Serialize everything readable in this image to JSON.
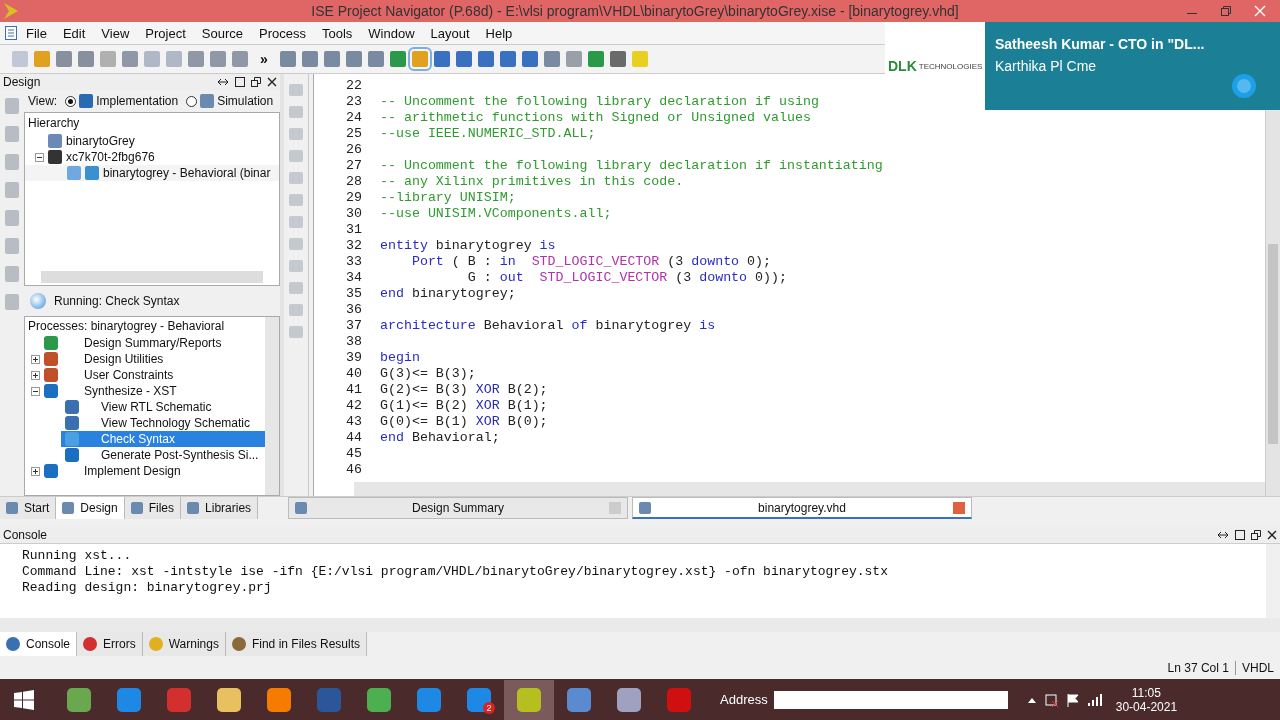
{
  "window": {
    "title": "ISE Project Navigator (P.68d) - E:\\vlsi program\\VHDL\\binarytoGrey\\binarytoGrey.xise - [binarytogrey.vhd]"
  },
  "menu": [
    "File",
    "Edit",
    "View",
    "Project",
    "Source",
    "Process",
    "Tools",
    "Window",
    "Layout",
    "Help"
  ],
  "toolbar": {
    "overflow": "»"
  },
  "design_panel": {
    "title": "Design",
    "view_label": "View:",
    "view_options": [
      {
        "label": "Implementation",
        "selected": true
      },
      {
        "label": "Simulation",
        "selected": false
      }
    ],
    "hierarchy_title": "Hierarchy",
    "hierarchy": [
      {
        "label": "binarytoGrey",
        "kind": "project"
      },
      {
        "label": "xc7k70t-2fbg676",
        "kind": "chip",
        "expanded": true,
        "children": [
          {
            "label": "binarytogrey - Behavioral (binar",
            "kind": "vhdl"
          }
        ]
      }
    ],
    "running": "Running: Check Syntax",
    "processes_title": "Processes: binarytogrey - Behavioral",
    "processes": [
      {
        "label": "Design Summary/Reports",
        "kind": "sigma",
        "selected": false
      },
      {
        "label": "Design Utilities",
        "kind": "tools",
        "expanded": false,
        "selected": false
      },
      {
        "label": "User Constraints",
        "kind": "tools",
        "expanded": false,
        "selected": false
      },
      {
        "label": "Synthesize - XST",
        "kind": "cycle",
        "expanded": true,
        "selected": false,
        "children": [
          {
            "label": "View RTL Schematic",
            "kind": "doc",
            "selected": false
          },
          {
            "label": "View Technology Schematic",
            "kind": "doc",
            "selected": false
          },
          {
            "label": "Check Syntax",
            "kind": "running",
            "selected": true
          },
          {
            "label": "Generate Post-Synthesis Si...",
            "kind": "cycle",
            "selected": false
          }
        ]
      },
      {
        "label": "Implement Design",
        "kind": "cycle",
        "expanded": false,
        "selected": false
      }
    ],
    "tabs": [
      {
        "label": "Start",
        "selected": false
      },
      {
        "label": "Design",
        "selected": true
      },
      {
        "label": "Files",
        "selected": false
      },
      {
        "label": "Libraries",
        "selected": false
      }
    ]
  },
  "editor": {
    "lines": [
      {
        "num": "22"
      },
      {
        "num": "23",
        "tokens": [
          {
            "text": "-- Uncomment the following library declaration if using",
            "kind": "comment"
          }
        ]
      },
      {
        "num": "24",
        "tokens": [
          {
            "text": "-- arithmetic functions with Signed or Unsigned values",
            "kind": "comment"
          }
        ]
      },
      {
        "num": "25",
        "tokens": [
          {
            "text": "--use IEEE.NUMERIC_STD.ALL;",
            "kind": "comment"
          }
        ]
      },
      {
        "num": "26"
      },
      {
        "num": "27",
        "tokens": [
          {
            "text": "-- Uncomment the following library declaration if instantiating",
            "kind": "comment"
          }
        ]
      },
      {
        "num": "28",
        "tokens": [
          {
            "text": "-- any Xilinx primitives in this code.",
            "kind": "comment"
          }
        ]
      },
      {
        "num": "29",
        "tokens": [
          {
            "text": "--library UNISIM;",
            "kind": "comment"
          }
        ]
      },
      {
        "num": "30",
        "tokens": [
          {
            "text": "--use UNISIM.VComponents.all;",
            "kind": "comment"
          }
        ]
      },
      {
        "num": "31"
      },
      {
        "num": "32",
        "tokens": [
          {
            "text": "entity",
            "kind": "keyword"
          },
          {
            "text": " binarytogrey ",
            "kind": "plain"
          },
          {
            "text": "is",
            "kind": "keyword"
          }
        ]
      },
      {
        "num": "33",
        "tokens": [
          {
            "text": "    Port",
            "kind": "keyword"
          },
          {
            "text": " ( B : ",
            "kind": "plain"
          },
          {
            "text": "in  ",
            "kind": "keyword"
          },
          {
            "text": "STD_LOGIC_VECTOR",
            "kind": "type"
          },
          {
            "text": " (3 ",
            "kind": "plain"
          },
          {
            "text": "downto",
            "kind": "keyword"
          },
          {
            "text": " 0);",
            "kind": "plain"
          }
        ]
      },
      {
        "num": "34",
        "tokens": [
          {
            "text": "           G : ",
            "kind": "plain"
          },
          {
            "text": "out  ",
            "kind": "keyword"
          },
          {
            "text": "STD_LOGIC_VECTOR",
            "kind": "type"
          },
          {
            "text": " (3 ",
            "kind": "plain"
          },
          {
            "text": "downto",
            "kind": "keyword"
          },
          {
            "text": " 0));",
            "kind": "plain"
          }
        ]
      },
      {
        "num": "35",
        "tokens": [
          {
            "text": "end",
            "kind": "keyword"
          },
          {
            "text": " binarytogrey;",
            "kind": "plain"
          }
        ]
      },
      {
        "num": "36"
      },
      {
        "num": "37",
        "tokens": [
          {
            "text": "architecture",
            "kind": "keyword"
          },
          {
            "text": " Behavioral ",
            "kind": "plain"
          },
          {
            "text": "of",
            "kind": "keyword"
          },
          {
            "text": " binarytogrey ",
            "kind": "plain"
          },
          {
            "text": "is",
            "kind": "keyword"
          }
        ]
      },
      {
        "num": "38"
      },
      {
        "num": "39",
        "tokens": [
          {
            "text": "begin",
            "kind": "keyword"
          }
        ]
      },
      {
        "num": "40",
        "tokens": [
          {
            "text": "G(3)<= B(3);",
            "kind": "plain"
          }
        ]
      },
      {
        "num": "41",
        "tokens": [
          {
            "text": "G(2)<= B(3) ",
            "kind": "plain"
          },
          {
            "text": "XOR",
            "kind": "keyword"
          },
          {
            "text": " B(2);",
            "kind": "plain"
          }
        ]
      },
      {
        "num": "42",
        "tokens": [
          {
            "text": "G(1)<= B(2) ",
            "kind": "plain"
          },
          {
            "text": "XOR",
            "kind": "keyword"
          },
          {
            "text": " B(1);",
            "kind": "plain"
          }
        ]
      },
      {
        "num": "43",
        "tokens": [
          {
            "text": "G(0)<= B(1) ",
            "kind": "plain"
          },
          {
            "text": "XOR",
            "kind": "keyword"
          },
          {
            "text": " B(0);",
            "kind": "plain"
          }
        ]
      },
      {
        "num": "44",
        "tokens": [
          {
            "text": "end",
            "kind": "keyword"
          },
          {
            "text": " Behavioral;",
            "kind": "plain"
          }
        ]
      },
      {
        "num": "45"
      },
      {
        "num": "46"
      }
    ],
    "tabs": [
      {
        "label": "Design Summary",
        "selected": false
      },
      {
        "label": "binarytogrey.vhd",
        "selected": true
      }
    ]
  },
  "console": {
    "title": "Console",
    "lines": [
      "Running xst...",
      "Command Line: xst -intstyle ise -ifn {E:/vlsi program/VHDL/binarytoGrey/binarytogrey.xst} -ofn binarytogrey.stx",
      "Reading design: binarytogrey.prj"
    ],
    "tabs": [
      {
        "label": "Console",
        "kind": "console",
        "selected": true
      },
      {
        "label": "Errors",
        "kind": "errors",
        "selected": false
      },
      {
        "label": "Warnings",
        "kind": "warnings",
        "selected": false
      },
      {
        "label": "Find in Files Results",
        "kind": "find",
        "selected": false
      }
    ]
  },
  "status_bar": {
    "position": "Ln 37 Col 1",
    "language": "VHDL"
  },
  "notification": {
    "logo": "DLK",
    "logo_sub": "TECHNOLOGIES",
    "title": "Satheesh Kumar - CTO in \"DL...",
    "message": "Karthika Pl Cme"
  },
  "taskbar": {
    "skype_badge": "2",
    "address_label": "Address",
    "time": "11:05",
    "date": "30-04-2021"
  }
}
